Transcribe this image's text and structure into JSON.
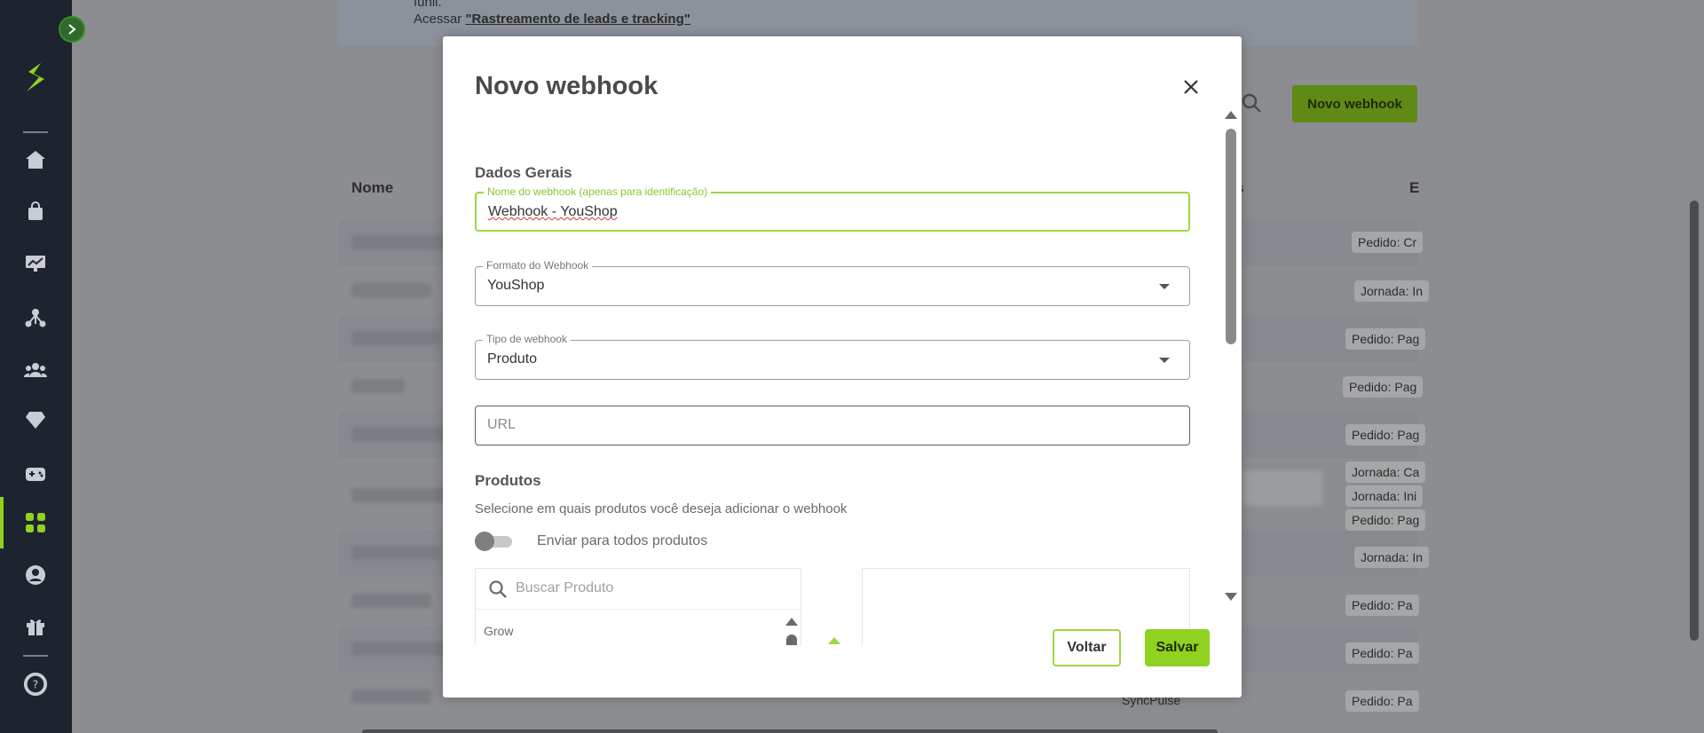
{
  "background": {
    "banner_line1": "funil.",
    "banner_line2_prefix": "Acessar ",
    "banner_link": "\"Rastreamento de leads e tracking\"",
    "new_button_label": "Novo webhook",
    "col_name": "Nome",
    "col_partial_s": "s",
    "col_partial_e": "E",
    "tags": [
      "Pedido: Cr",
      "Jornada: In",
      "Pedido: Pag",
      "Pedido: Pag",
      "Pedido: Pag",
      "Jornada: Ca",
      "Jornada: Ini",
      "Pedido: Pag",
      "Jornada: In",
      "Pedido: Pa",
      "Pedido: Pa",
      "Pedido: Pa"
    ],
    "sync_text": "SyncPulse"
  },
  "modal": {
    "title": "Novo webhook",
    "section_general": "Dados Gerais",
    "name_field": {
      "label": "Nome do webhook (apenas para identificação)",
      "value": "Webhook - YouShop"
    },
    "format_field": {
      "label": "Formato do Webhook",
      "value": "YouShop"
    },
    "type_field": {
      "label": "Tipo de webhook",
      "value": "Produto"
    },
    "url_field": {
      "placeholder": "URL"
    },
    "section_products": "Produtos",
    "products_desc": "Selecione em quais produtos você deseja adicionar o webhook",
    "toggle_label": "Enviar para todos produtos",
    "toggle_on": false,
    "product_search_placeholder": "Buscar Produto",
    "product_items": [
      "Grow"
    ],
    "back_label": "Voltar",
    "save_label": "Salvar"
  },
  "colors": {
    "accent": "#8fd21f",
    "sidebar": "#1e2330",
    "focus_border": "#9ed641"
  }
}
